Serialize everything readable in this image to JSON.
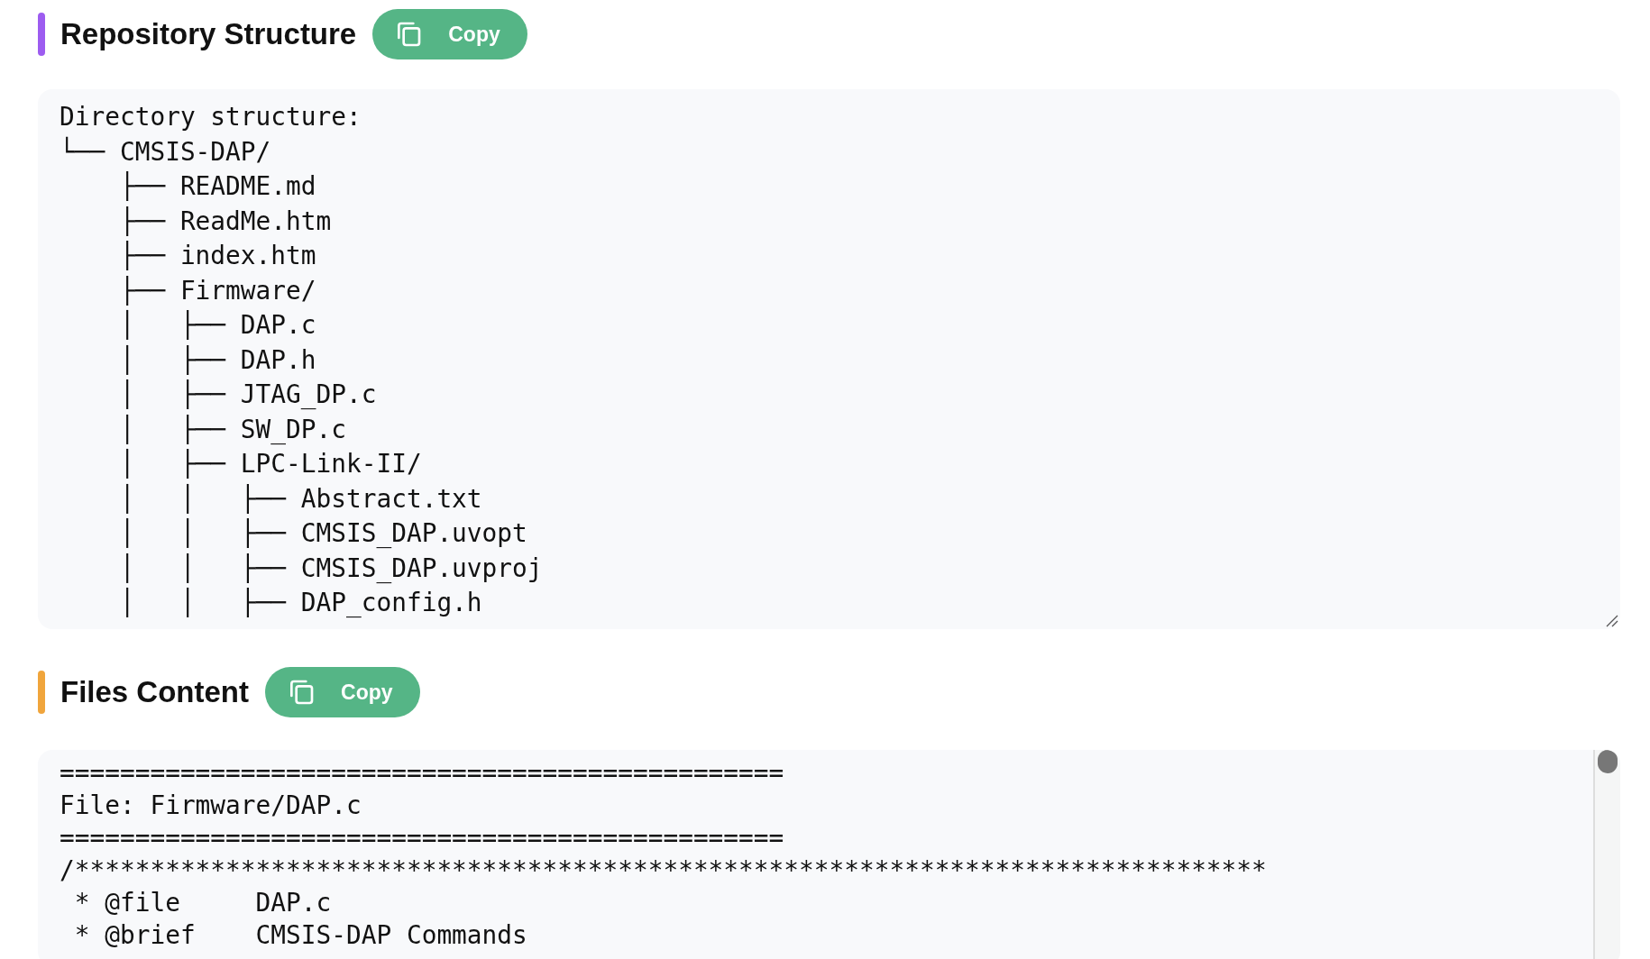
{
  "sections": [
    {
      "title": "Repository Structure",
      "color": "#9d5cf0",
      "copy_button": "Copy",
      "resizable": true,
      "scrollbar": false,
      "lines": [
        "Directory structure:",
        "└── CMSIS-DAP/",
        "    ├── README.md",
        "    ├── ReadMe.htm",
        "    ├── index.htm",
        "    ├── Firmware/",
        "    │   ├── DAP.c",
        "    │   ├── DAP.h",
        "    │   ├── JTAG_DP.c",
        "    │   ├── SW_DP.c",
        "    │   ├── LPC-Link-II/",
        "    │   │   ├── Abstract.txt",
        "    │   │   ├── CMSIS_DAP.uvopt",
        "    │   │   ├── CMSIS_DAP.uvproj",
        "    │   │   ├── DAP_config.h"
      ]
    },
    {
      "title": "Files Content",
      "color": "#f0a53c",
      "copy_button": "Copy",
      "resizable": false,
      "scrollbar": true,
      "lines": [
        "================================================",
        "File: Firmware/DAP.c",
        "================================================",
        "/*******************************************************************************",
        " * @file     DAP.c",
        " * @brief    CMSIS-DAP Commands"
      ]
    }
  ]
}
